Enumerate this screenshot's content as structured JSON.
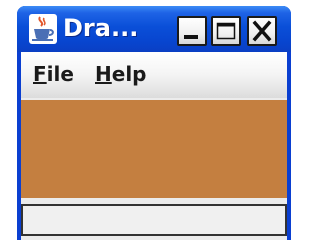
{
  "window": {
    "title": "Dra...",
    "icon": "java-cup-icon",
    "buttons": [
      "minimize-icon",
      "maximize-icon",
      "close-icon"
    ]
  },
  "menu": {
    "file": {
      "mnemonic": "F",
      "rest": "ile"
    },
    "help": {
      "mnemonic": "H",
      "rest": "elp"
    }
  },
  "canvas": {
    "color": "#c47f40"
  },
  "statusbar": {
    "text": ""
  },
  "colors": {
    "titlebar": "#0a4fd8",
    "menubar": "#f4f4f4",
    "canvas": "#c47f40"
  }
}
